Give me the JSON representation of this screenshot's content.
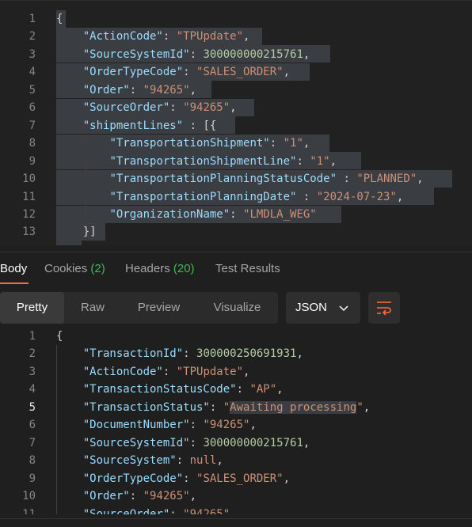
{
  "request": {
    "lines": [
      {
        "n": "1",
        "tokens": [
          {
            "t": "{",
            "c": "p"
          }
        ]
      },
      {
        "n": "2",
        "tokens": [
          {
            "t": "    ",
            "c": "p"
          },
          {
            "t": "\"ActionCode\"",
            "c": "k"
          },
          {
            "t": ": ",
            "c": "p"
          },
          {
            "t": "\"TPUpdate\"",
            "c": "s"
          },
          {
            "t": ",",
            "c": "p"
          }
        ]
      },
      {
        "n": "3",
        "tokens": [
          {
            "t": "    ",
            "c": "p"
          },
          {
            "t": "\"SourceSystemId\"",
            "c": "k"
          },
          {
            "t": ": ",
            "c": "p"
          },
          {
            "t": "300000000215761",
            "c": "n"
          },
          {
            "t": ",",
            "c": "p"
          }
        ]
      },
      {
        "n": "4",
        "tokens": [
          {
            "t": "    ",
            "c": "p"
          },
          {
            "t": "\"OrderTypeCode\"",
            "c": "k"
          },
          {
            "t": ": ",
            "c": "p"
          },
          {
            "t": "\"SALES_ORDER\"",
            "c": "s"
          },
          {
            "t": ",",
            "c": "p"
          }
        ]
      },
      {
        "n": "5",
        "tokens": [
          {
            "t": "    ",
            "c": "p"
          },
          {
            "t": "\"Order\"",
            "c": "k"
          },
          {
            "t": ": ",
            "c": "p"
          },
          {
            "t": "\"94265\"",
            "c": "s"
          },
          {
            "t": ",",
            "c": "p"
          }
        ]
      },
      {
        "n": "6",
        "tokens": [
          {
            "t": "    ",
            "c": "p"
          },
          {
            "t": "\"SourceOrder\"",
            "c": "k"
          },
          {
            "t": ": ",
            "c": "p"
          },
          {
            "t": "\"94265\"",
            "c": "s"
          },
          {
            "t": ",",
            "c": "p"
          }
        ]
      },
      {
        "n": "7",
        "tokens": [
          {
            "t": "    ",
            "c": "p"
          },
          {
            "t": "\"shipmentLines\"",
            "c": "k"
          },
          {
            "t": " : [{",
            "c": "p"
          }
        ]
      },
      {
        "n": "8",
        "tokens": [
          {
            "t": "        ",
            "c": "p"
          },
          {
            "t": "\"TransportationShipment\"",
            "c": "k"
          },
          {
            "t": ": ",
            "c": "p"
          },
          {
            "t": "\"1\"",
            "c": "s"
          },
          {
            "t": ",",
            "c": "p"
          }
        ]
      },
      {
        "n": "9",
        "tokens": [
          {
            "t": "        ",
            "c": "p"
          },
          {
            "t": "\"TransportationShipmentLine\"",
            "c": "k"
          },
          {
            "t": ": ",
            "c": "p"
          },
          {
            "t": "\"1\"",
            "c": "s"
          },
          {
            "t": ",",
            "c": "p"
          }
        ]
      },
      {
        "n": "10",
        "tokens": [
          {
            "t": "        ",
            "c": "p"
          },
          {
            "t": "\"TransportationPlanningStatusCode\"",
            "c": "k"
          },
          {
            "t": " : ",
            "c": "p"
          },
          {
            "t": "\"PLANNED\"",
            "c": "s"
          },
          {
            "t": ",",
            "c": "p"
          }
        ]
      },
      {
        "n": "11",
        "tokens": [
          {
            "t": "        ",
            "c": "p"
          },
          {
            "t": "\"TransportationPlanningDate\"",
            "c": "k"
          },
          {
            "t": " : ",
            "c": "p"
          },
          {
            "t": "\"2024-07-23\"",
            "c": "s"
          },
          {
            "t": ",",
            "c": "p"
          }
        ]
      },
      {
        "n": "12",
        "tokens": [
          {
            "t": "        ",
            "c": "p"
          },
          {
            "t": "\"OrganizationName\"",
            "c": "k"
          },
          {
            "t": ": ",
            "c": "p"
          },
          {
            "t": "\"LMDLA_WEG\"",
            "c": "s"
          }
        ]
      },
      {
        "n": "13",
        "tokens": [
          {
            "t": "    ",
            "c": "p"
          },
          {
            "t": "}]",
            "c": "p"
          }
        ]
      }
    ]
  },
  "response_tabs": {
    "body": "Body",
    "cookies": "Cookies",
    "cookies_count": "(2)",
    "headers": "Headers",
    "headers_count": "(20)",
    "tests": "Test Results"
  },
  "view": {
    "pretty": "Pretty",
    "raw": "Raw",
    "preview": "Preview",
    "visualize": "Visualize",
    "format": "JSON"
  },
  "response": {
    "lines": [
      {
        "n": "1",
        "tokens": [
          {
            "t": "{",
            "c": "p"
          }
        ]
      },
      {
        "n": "2",
        "tokens": [
          {
            "t": "    ",
            "c": "p"
          },
          {
            "t": "\"TransactionId\"",
            "c": "k"
          },
          {
            "t": ": ",
            "c": "p"
          },
          {
            "t": "300000250691931",
            "c": "n"
          },
          {
            "t": ",",
            "c": "p"
          }
        ]
      },
      {
        "n": "3",
        "tokens": [
          {
            "t": "    ",
            "c": "p"
          },
          {
            "t": "\"ActionCode\"",
            "c": "k"
          },
          {
            "t": ": ",
            "c": "p"
          },
          {
            "t": "\"TPUpdate\"",
            "c": "s"
          },
          {
            "t": ",",
            "c": "p"
          }
        ]
      },
      {
        "n": "4",
        "tokens": [
          {
            "t": "    ",
            "c": "p"
          },
          {
            "t": "\"TransactionStatusCode\"",
            "c": "k"
          },
          {
            "t": ": ",
            "c": "p"
          },
          {
            "t": "\"AP\"",
            "c": "s"
          },
          {
            "t": ",",
            "c": "p"
          }
        ]
      },
      {
        "n": "5",
        "active": true,
        "tokens": [
          {
            "t": "    ",
            "c": "p"
          },
          {
            "t": "\"TransactionStatus\"",
            "c": "k"
          },
          {
            "t": ": ",
            "c": "p"
          },
          {
            "t": "\"",
            "c": "s"
          },
          {
            "t": "Awaiting processing",
            "c": "s hl-word"
          },
          {
            "t": "\"",
            "c": "s"
          },
          {
            "t": ",",
            "c": "p"
          }
        ]
      },
      {
        "n": "6",
        "tokens": [
          {
            "t": "    ",
            "c": "p"
          },
          {
            "t": "\"DocumentNumber\"",
            "c": "k"
          },
          {
            "t": ": ",
            "c": "p"
          },
          {
            "t": "\"94265\"",
            "c": "s"
          },
          {
            "t": ",",
            "c": "p"
          }
        ]
      },
      {
        "n": "7",
        "tokens": [
          {
            "t": "    ",
            "c": "p"
          },
          {
            "t": "\"SourceSystemId\"",
            "c": "k"
          },
          {
            "t": ": ",
            "c": "p"
          },
          {
            "t": "300000000215761",
            "c": "n"
          },
          {
            "t": ",",
            "c": "p"
          }
        ]
      },
      {
        "n": "8",
        "tokens": [
          {
            "t": "    ",
            "c": "p"
          },
          {
            "t": "\"SourceSystem\"",
            "c": "k"
          },
          {
            "t": ": ",
            "c": "p"
          },
          {
            "t": "null",
            "c": "nul"
          },
          {
            "t": ",",
            "c": "p"
          }
        ]
      },
      {
        "n": "9",
        "tokens": [
          {
            "t": "    ",
            "c": "p"
          },
          {
            "t": "\"OrderTypeCode\"",
            "c": "k"
          },
          {
            "t": ": ",
            "c": "p"
          },
          {
            "t": "\"SALES_ORDER\"",
            "c": "s"
          },
          {
            "t": ",",
            "c": "p"
          }
        ]
      },
      {
        "n": "10",
        "tokens": [
          {
            "t": "    ",
            "c": "p"
          },
          {
            "t": "\"Order\"",
            "c": "k"
          },
          {
            "t": ": ",
            "c": "p"
          },
          {
            "t": "\"94265\"",
            "c": "s"
          },
          {
            "t": ",",
            "c": "p"
          }
        ]
      },
      {
        "n": "11",
        "tokens": [
          {
            "t": "    ",
            "c": "p"
          },
          {
            "t": "\"SourceOrder\"",
            "c": "k"
          },
          {
            "t": ": ",
            "c": "p"
          },
          {
            "t": "\"94265\"",
            "c": "s"
          }
        ]
      }
    ]
  },
  "colors": {
    "accent": "#ff6c37",
    "count_green": "#3fb950",
    "key": "#9cdcfe",
    "string": "#ce9178",
    "number": "#b5cea8"
  }
}
